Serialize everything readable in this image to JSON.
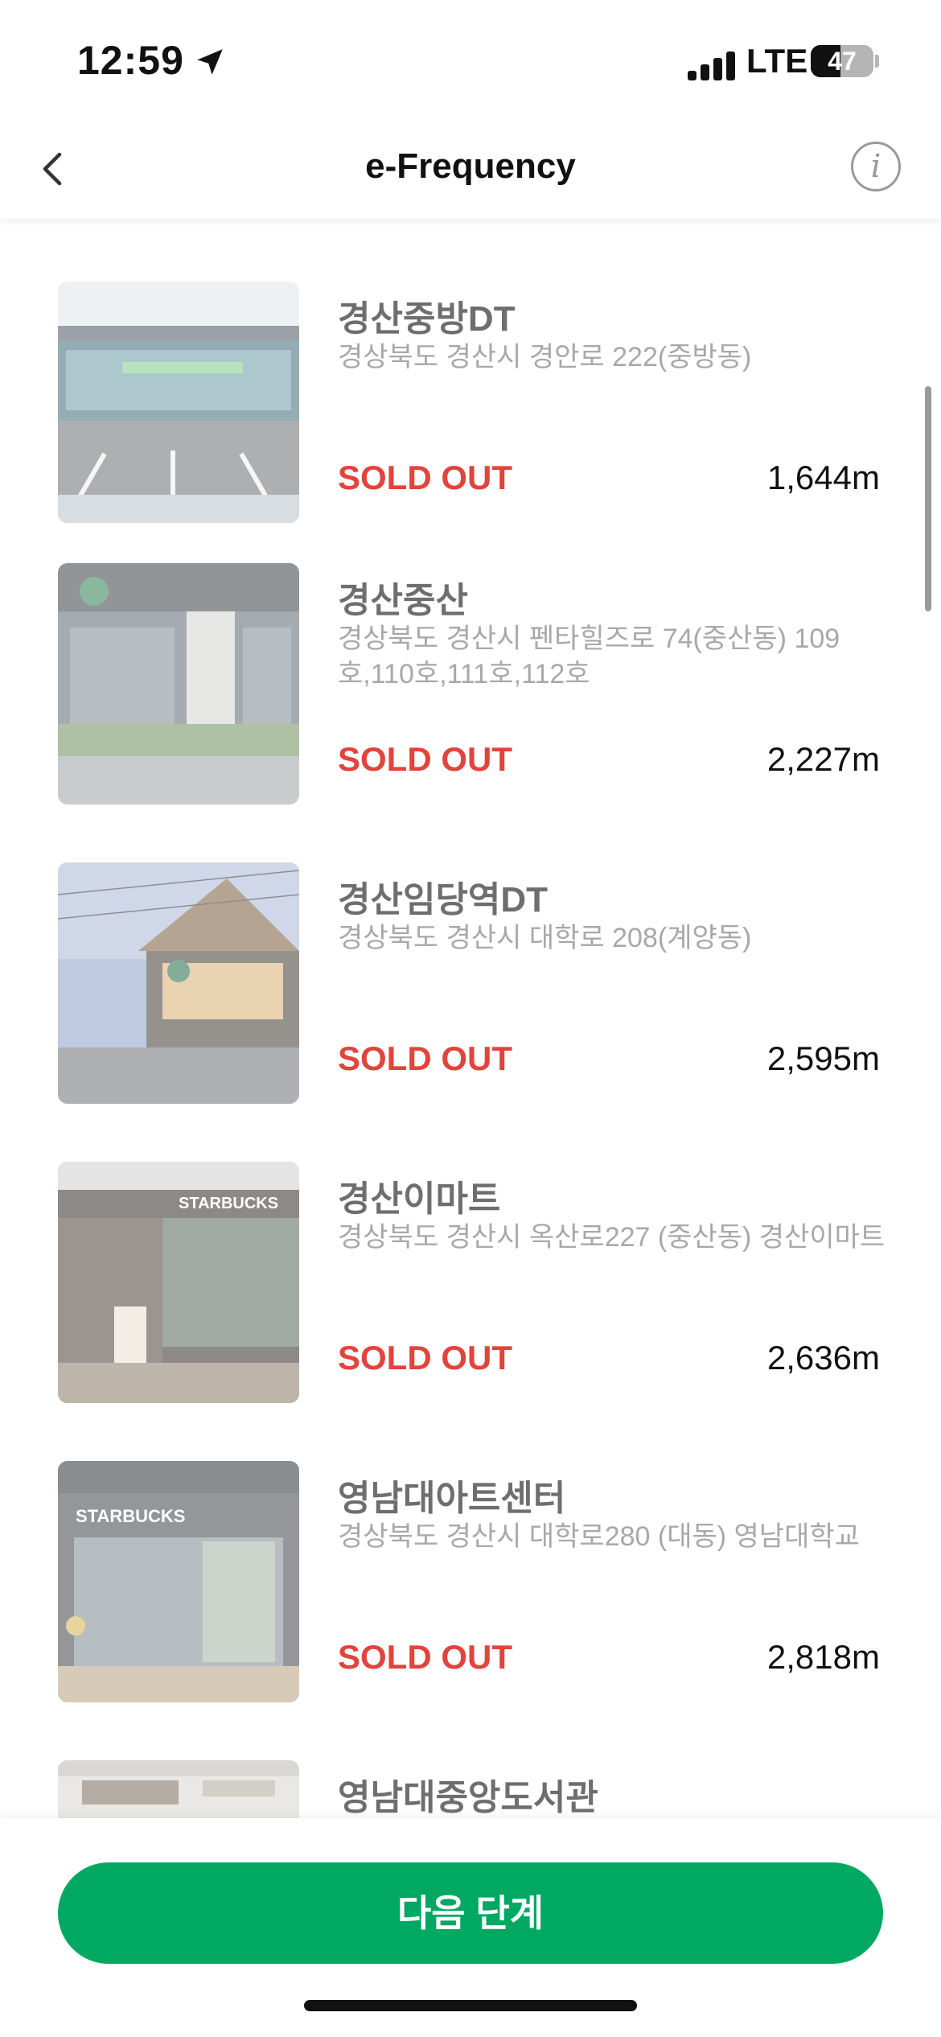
{
  "status_bar": {
    "time": "12:59",
    "network": "LTE",
    "battery": "47",
    "battery_level": 0.47
  },
  "nav": {
    "title": "e-Frequency",
    "back_icon": "chevron-left-icon",
    "info_icon": "info-icon"
  },
  "stores": [
    {
      "name": "경산중방DT",
      "address": "경상북도 경산시 경안로 222(중방동)",
      "status": "SOLD OUT",
      "distance": "1,644m"
    },
    {
      "name": "경산중산",
      "address": "경상북도 경산시 펜타힐즈로 74(중산동) 109호,110호,111호,112호",
      "status": "SOLD OUT",
      "distance": "2,227m"
    },
    {
      "name": "경산임당역DT",
      "address": "경상북도 경산시 대학로 208(계양동)",
      "status": "SOLD OUT",
      "distance": "2,595m"
    },
    {
      "name": "경산이마트",
      "address": "경상북도 경산시 옥산로227 (중산동) 경산이마트",
      "status": "SOLD OUT",
      "distance": "2,636m"
    },
    {
      "name": "영남대아트센터",
      "address": "경상북도 경산시 대학로280 (대동) 영남대학교",
      "status": "SOLD OUT",
      "distance": "2,818m"
    },
    {
      "name": "영남대중앙도서관",
      "address": "",
      "status": "",
      "distance": ""
    }
  ],
  "next_button": {
    "label": "다음 단계"
  },
  "colors": {
    "accent": "#00a862",
    "sold_out": "#e1443c"
  }
}
